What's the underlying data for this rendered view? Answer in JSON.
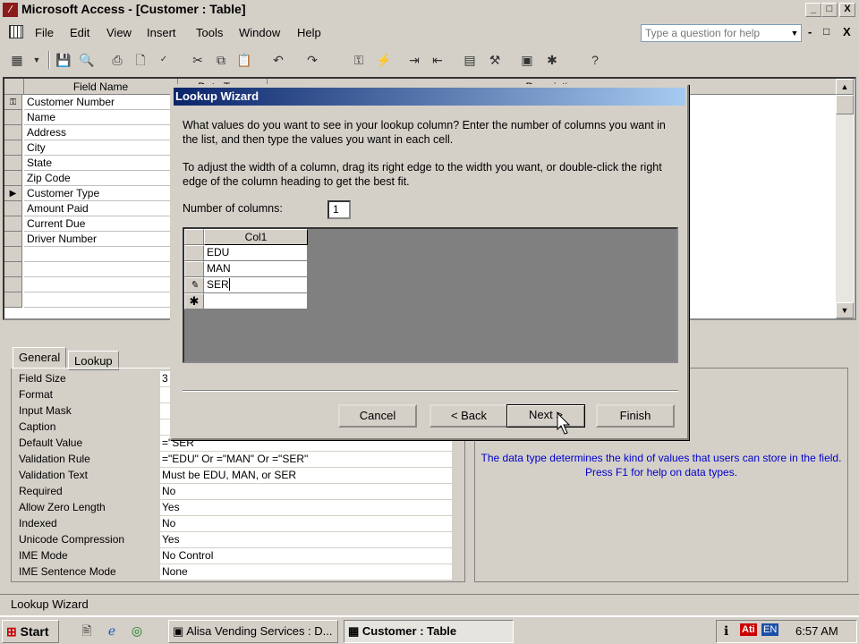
{
  "window": {
    "title": "Microsoft Access - [Customer : Table]",
    "caption_buttons": [
      "_",
      "□",
      "X"
    ]
  },
  "menubar": {
    "items": [
      "File",
      "Edit",
      "View",
      "Insert",
      "Tools",
      "Window",
      "Help"
    ],
    "ask_placeholder": "Type a question for help",
    "doc_buttons": [
      "-",
      "□",
      "X"
    ]
  },
  "grid": {
    "headers": {
      "field_name": "Field Name",
      "data_type": "Data Type",
      "description": "Description"
    },
    "rows": [
      {
        "name": "Customer Number",
        "key": true
      },
      {
        "name": "Name"
      },
      {
        "name": "Address"
      },
      {
        "name": "City"
      },
      {
        "name": "State"
      },
      {
        "name": "Zip Code"
      },
      {
        "name": "Customer Type",
        "current": true
      },
      {
        "name": "Amount Paid"
      },
      {
        "name": "Current Due"
      },
      {
        "name": "Driver Number"
      }
    ]
  },
  "properties": {
    "tabs": [
      "General",
      "Lookup"
    ],
    "rows": [
      {
        "label": "Field Size",
        "value": "3"
      },
      {
        "label": "Format",
        "value": ""
      },
      {
        "label": "Input Mask",
        "value": ""
      },
      {
        "label": "Caption",
        "value": ""
      },
      {
        "label": "Default Value",
        "value": "=\"SER\""
      },
      {
        "label": "Validation Rule",
        "value": "=\"EDU\" Or =\"MAN\" Or =\"SER\""
      },
      {
        "label": "Validation Text",
        "value": "Must be EDU, MAN, or SER"
      },
      {
        "label": "Required",
        "value": "No"
      },
      {
        "label": "Allow Zero Length",
        "value": "Yes"
      },
      {
        "label": "Indexed",
        "value": "No"
      },
      {
        "label": "Unicode Compression",
        "value": "Yes"
      },
      {
        "label": "IME Mode",
        "value": "No Control"
      },
      {
        "label": "IME Sentence Mode",
        "value": "None"
      }
    ],
    "help_text": "The data type determines the kind of values that users can store in the field.  Press F1 for help on data types."
  },
  "dialog": {
    "title": "Lookup Wizard",
    "para1": "What values do you want to see in your lookup column? Enter the number of columns you want in the list, and then type the values you want in each cell.",
    "para2": "To adjust the width of a column, drag its right edge to the width you want, or double-click the right edge of the column heading to get the best fit.",
    "columns_label": "Number of columns:",
    "columns_value": "1",
    "column_header": "Col1",
    "values": [
      "EDU",
      "MAN",
      "SER",
      ""
    ],
    "buttons": {
      "cancel": "Cancel",
      "back": "< Back",
      "next": "Next >",
      "finish": "Finish"
    }
  },
  "statusbar": {
    "text": "Lookup Wizard"
  },
  "taskbar": {
    "start": "Start",
    "tasks": [
      "Alisa Vending Services : D...",
      "Customer : Table"
    ],
    "tray_lang": "EN",
    "clock": "6:57 AM"
  }
}
